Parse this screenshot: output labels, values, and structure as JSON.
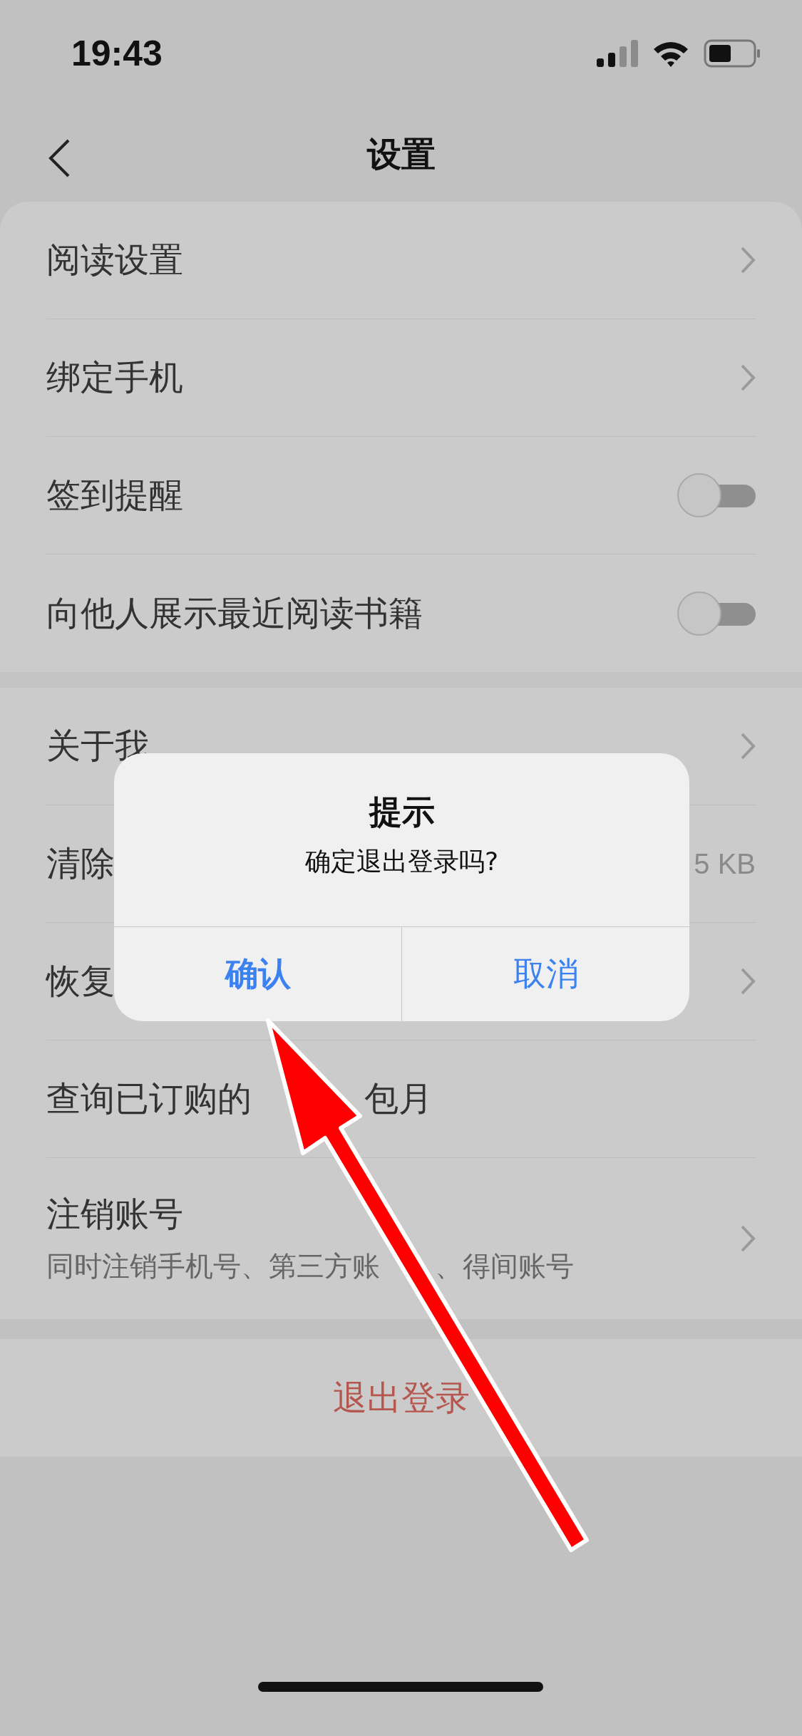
{
  "status_bar": {
    "time": "19:43"
  },
  "nav": {
    "title": "设置"
  },
  "groups": [
    {
      "items": [
        {
          "kind": "link",
          "title": "阅读设置"
        },
        {
          "kind": "link",
          "title": "绑定手机"
        },
        {
          "kind": "toggle",
          "title": "签到提醒",
          "on": false
        },
        {
          "kind": "toggle",
          "title": "向他人展示最近阅读书籍",
          "on": false
        }
      ]
    },
    {
      "items": [
        {
          "kind": "link",
          "title": "关于我"
        },
        {
          "kind": "value",
          "title": "清除",
          "value": "5 KB"
        },
        {
          "kind": "link",
          "title": "恢复"
        },
        {
          "kind": "plain",
          "title": "查询已订购的",
          "title_end": "包月"
        },
        {
          "kind": "link",
          "title": "注销账号",
          "subtitle": "同时注销手机号、第三方账",
          "subtitle_end": "、得间账号"
        }
      ]
    }
  ],
  "logout": {
    "label": "退出登录"
  },
  "dialog": {
    "title": "提示",
    "message": "确定退出登录吗?",
    "buttons": [
      {
        "label": "确认",
        "primary": true
      },
      {
        "label": "取消",
        "primary": false
      }
    ]
  }
}
